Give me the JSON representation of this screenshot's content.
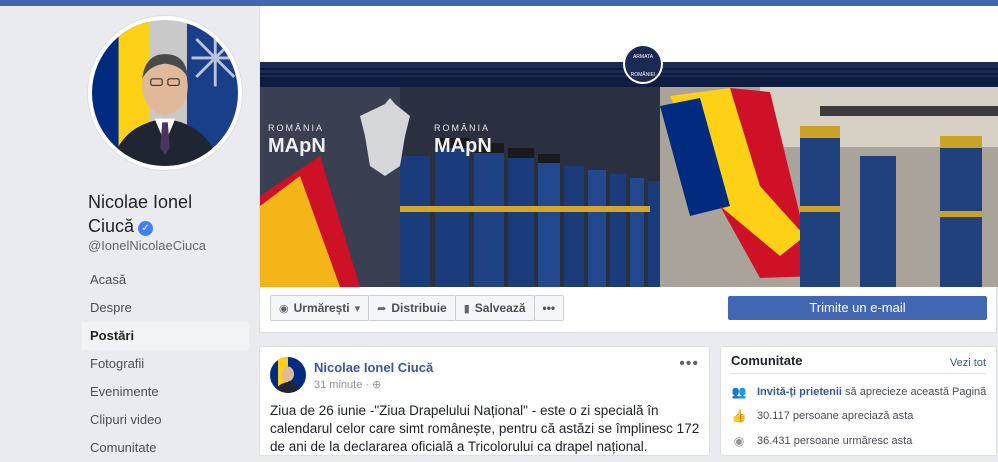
{
  "profile": {
    "name_line1": "Nicolae Ionel",
    "name_line2": "Ciucă",
    "verified_glyph": "✓",
    "handle": "@IonelNicolaeCiuca"
  },
  "nav": {
    "items": [
      {
        "label": "Acasă"
      },
      {
        "label": "Despre"
      },
      {
        "label": "Postări"
      },
      {
        "label": "Fotografii"
      },
      {
        "label": "Evenimente"
      },
      {
        "label": "Clipuri video"
      },
      {
        "label": "Comunitate"
      }
    ]
  },
  "cover": {
    "logo_text": "ROMÂNIA",
    "logo_acronym": "MApN",
    "emblem_top": "ARMATA",
    "emblem_bottom": "ROMÂNIEI"
  },
  "actions": {
    "follow": "Urmărești",
    "share": "Distribuie",
    "save": "Salvează",
    "more": "•••",
    "email": "Trimite un e-mail"
  },
  "post": {
    "author": "Nicolae Ionel Ciucă",
    "time": "31 minute",
    "more": "•••",
    "text": "Ziua de 26 iunie -\"Ziua Drapelului Național\" - este o zi specială în calendarul celor care simt românește, pentru că astăzi se împlinesc 172 de ani de la declararea oficială a Tricolorului ca drapel național."
  },
  "community": {
    "title": "Comunitate",
    "see_all": "Vezi tot",
    "invite_link": "Invită-ți prietenii",
    "invite_rest": "să aprecieze această Pagină",
    "likes": "30.117 persoane apreciază asta",
    "follows": "36.431 persoane urmăresc asta"
  },
  "colors": {
    "accent": "#4267b2",
    "link": "#385898",
    "flag_blue": "#002b7f",
    "flag_yellow": "#fcd116",
    "flag_red": "#ce1126"
  }
}
